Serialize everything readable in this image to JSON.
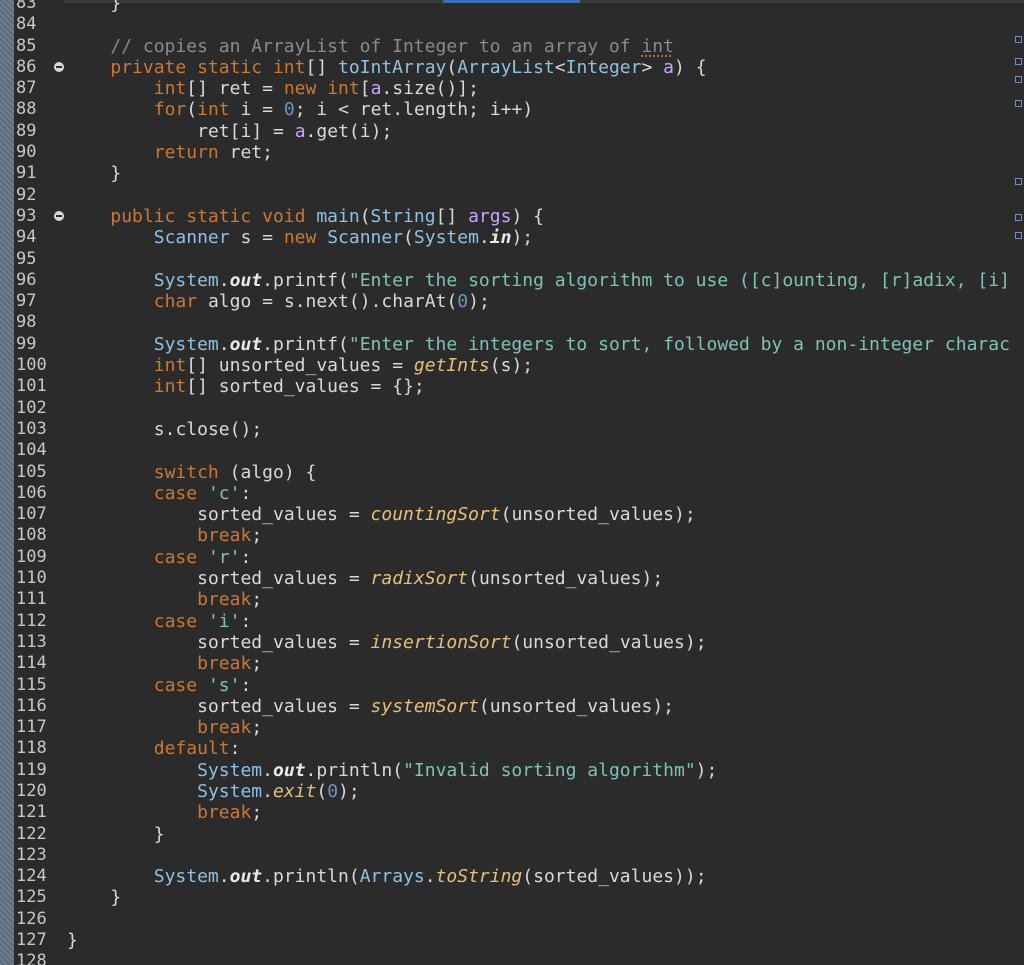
{
  "editor": {
    "accent": "#3d6db5",
    "background": "#2b2b2b",
    "lines": [
      {
        "n": "83",
        "fold": false,
        "t": "    }"
      },
      {
        "n": "84",
        "fold": false,
        "t": ""
      },
      {
        "n": "85",
        "fold": false,
        "t": "    // copies an ArrayList of Integer to an array of int"
      },
      {
        "n": "86",
        "fold": true,
        "t": "    private static int[] toIntArray(ArrayList<Integer> a) {"
      },
      {
        "n": "87",
        "fold": false,
        "t": "        int[] ret = new int[a.size()];"
      },
      {
        "n": "88",
        "fold": false,
        "t": "        for(int i = 0; i < ret.length; i++)"
      },
      {
        "n": "89",
        "fold": false,
        "t": "            ret[i] = a.get(i);"
      },
      {
        "n": "90",
        "fold": false,
        "t": "        return ret;"
      },
      {
        "n": "91",
        "fold": false,
        "t": "    }"
      },
      {
        "n": "92",
        "fold": false,
        "t": ""
      },
      {
        "n": "93",
        "fold": true,
        "t": "    public static void main(String[] args) {"
      },
      {
        "n": "94",
        "fold": false,
        "t": "        Scanner s = new Scanner(System.in);"
      },
      {
        "n": "95",
        "fold": false,
        "t": ""
      },
      {
        "n": "96",
        "fold": false,
        "t": "        System.out.printf(\"Enter the sorting algorithm to use ([c]ounting, [r]adix, [i]"
      },
      {
        "n": "97",
        "fold": false,
        "t": "        char algo = s.next().charAt(0);"
      },
      {
        "n": "98",
        "fold": false,
        "t": ""
      },
      {
        "n": "99",
        "fold": false,
        "t": "        System.out.printf(\"Enter the integers to sort, followed by a non-integer charac"
      },
      {
        "n": "100",
        "fold": false,
        "t": "        int[] unsorted_values = getInts(s);"
      },
      {
        "n": "101",
        "fold": false,
        "t": "        int[] sorted_values = {};"
      },
      {
        "n": "102",
        "fold": false,
        "t": ""
      },
      {
        "n": "103",
        "fold": false,
        "t": "        s.close();"
      },
      {
        "n": "104",
        "fold": false,
        "t": ""
      },
      {
        "n": "105",
        "fold": false,
        "t": "        switch (algo) {"
      },
      {
        "n": "106",
        "fold": false,
        "t": "        case 'c':"
      },
      {
        "n": "107",
        "fold": false,
        "t": "            sorted_values = countingSort(unsorted_values);"
      },
      {
        "n": "108",
        "fold": false,
        "t": "            break;"
      },
      {
        "n": "109",
        "fold": false,
        "t": "        case 'r':"
      },
      {
        "n": "110",
        "fold": false,
        "t": "            sorted_values = radixSort(unsorted_values);"
      },
      {
        "n": "111",
        "fold": false,
        "t": "            break;"
      },
      {
        "n": "112",
        "fold": false,
        "t": "        case 'i':"
      },
      {
        "n": "113",
        "fold": false,
        "t": "            sorted_values = insertionSort(unsorted_values);"
      },
      {
        "n": "114",
        "fold": false,
        "t": "            break;"
      },
      {
        "n": "115",
        "fold": false,
        "t": "        case 's':"
      },
      {
        "n": "116",
        "fold": false,
        "t": "            sorted_values = systemSort(unsorted_values);"
      },
      {
        "n": "117",
        "fold": false,
        "t": "            break;"
      },
      {
        "n": "118",
        "fold": false,
        "t": "        default:"
      },
      {
        "n": "119",
        "fold": false,
        "t": "            System.out.println(\"Invalid sorting algorithm\");"
      },
      {
        "n": "120",
        "fold": false,
        "t": "            System.exit(0);"
      },
      {
        "n": "121",
        "fold": false,
        "t": "            break;"
      },
      {
        "n": "122",
        "fold": false,
        "t": "        }"
      },
      {
        "n": "123",
        "fold": false,
        "t": ""
      },
      {
        "n": "124",
        "fold": false,
        "t": "        System.out.println(Arrays.toString(sorted_values));"
      },
      {
        "n": "125",
        "fold": false,
        "t": "    }"
      },
      {
        "n": "126",
        "fold": false,
        "t": ""
      },
      {
        "n": "127",
        "fold": false,
        "t": "}"
      },
      {
        "n": "128",
        "fold": false,
        "t": ""
      }
    ]
  }
}
